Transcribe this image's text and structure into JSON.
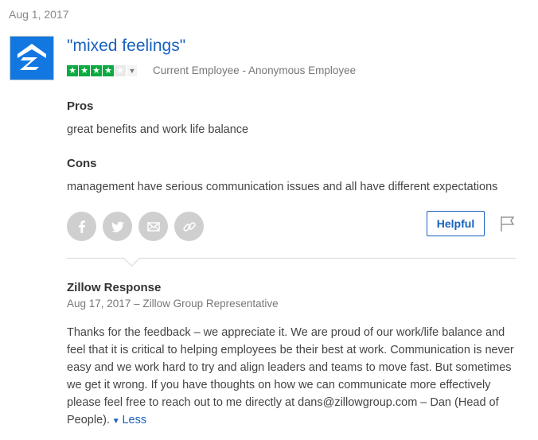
{
  "review": {
    "date": "Aug 1, 2017",
    "title": "\"mixed feelings\"",
    "rating": 4,
    "rating_max": 5,
    "author": "Current Employee - Anonymous Employee",
    "pros_label": "Pros",
    "pros_text": "great benefits and work life balance",
    "cons_label": "Cons",
    "cons_text": "management have serious communication issues and all have different expectations",
    "helpful_label": "Helpful"
  },
  "share_icons": [
    "facebook-icon",
    "twitter-icon",
    "email-icon",
    "link-icon"
  ],
  "response": {
    "title": "Zillow Response",
    "meta": "Aug 17, 2017 – Zillow Group Representative",
    "body": "Thanks for the feedback – we appreciate it. We are proud of our work/life balance and feel that it is critical to helping employees be their best at work. Communication is never easy and we work hard to try and align leaders and teams to move fast. But sometimes we get it wrong. If you have thoughts on how we can communicate more effectively please feel free to reach out to me directly at dans@zillowgroup.com – Dan (Head of People).",
    "less_label": "Less"
  },
  "colors": {
    "brand_blue": "#1277e1",
    "link_blue": "#1861bf",
    "star_green": "#0caa41",
    "share_gray": "#cfcfcf"
  }
}
